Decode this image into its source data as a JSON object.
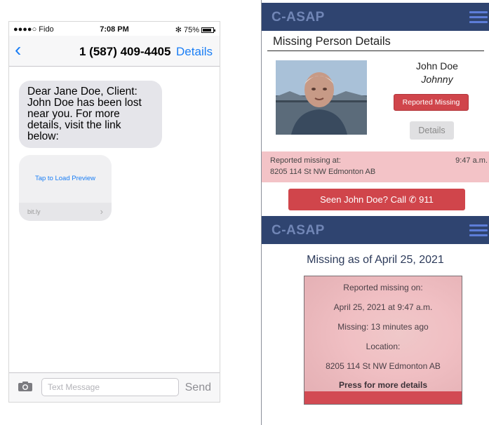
{
  "messages": {
    "status": {
      "carrier": "●●●●○ Fido",
      "time": "7:08 PM",
      "battery": "75%"
    },
    "nav": {
      "back_glyph": "‹",
      "title": "1 (587) 409-4405",
      "details": "Details"
    },
    "message_text": "Dear Jane Doe, Client: John Doe has been lost near you. For more details, visit the link below:",
    "preview": {
      "tap": "Tap to Load Preview",
      "url": "bit.ly",
      "chevron": "›"
    },
    "composer": {
      "placeholder": "Text Message",
      "send": "Send"
    }
  },
  "app": {
    "brand": "C-ASAP",
    "details_title": "Missing Person Details",
    "person": {
      "name": "John Doe",
      "nickname": "Johnny"
    },
    "reported_button": "Reported Missing",
    "details_button": "Details",
    "reported_label": "Reported missing at:",
    "reported_address": "8205 114 St NW Edmonton AB",
    "reported_time": "9:47 a.m.",
    "seen_button": "Seen John Doe? Call",
    "seen_number": "911",
    "missing_as": "Missing as of April 25, 2021",
    "card": {
      "line1": "Reported missing on:",
      "line2": "April 25, 2021 at 9:47 a.m.",
      "line3": "Missing: 13 minutes ago",
      "line4": "Location:",
      "line5": "8205 114 St NW Edmonton AB",
      "line6": "Press for more details"
    },
    "colors": {
      "appbar": "#2f4470",
      "brand": "#7186b6",
      "accent": "#d0454b",
      "strip": "#f3c3c7"
    },
    "icons": [
      "hamburger-menu-icon",
      "phone-icon",
      "camera-icon",
      "chevron-left-icon"
    ]
  }
}
